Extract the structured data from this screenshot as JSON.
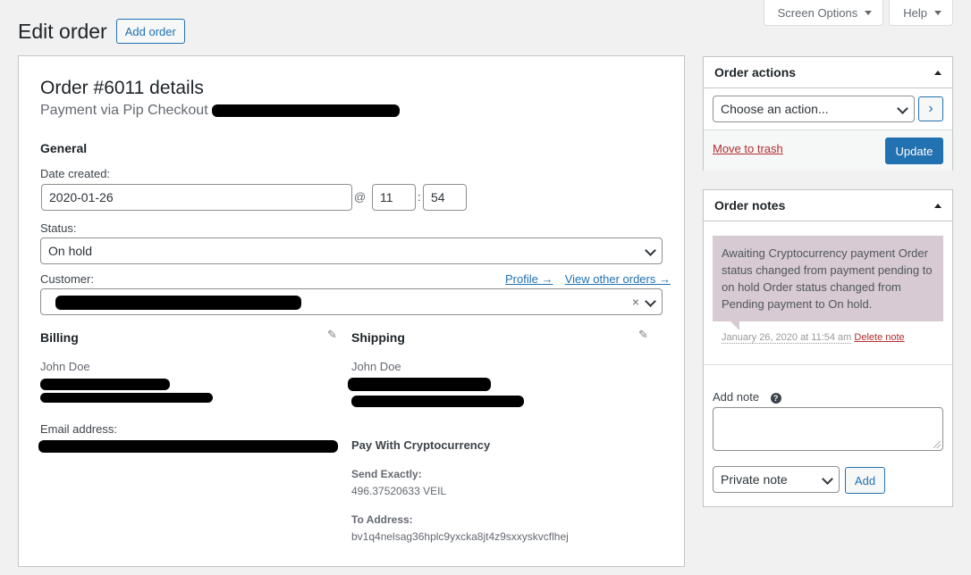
{
  "screen_meta": {
    "screen_options_label": "Screen Options",
    "help_label": "Help"
  },
  "header": {
    "title": "Edit order",
    "add_order_label": "Add order"
  },
  "order": {
    "title": "Order #6011 details",
    "payment_via": "Payment via Pip Checkout",
    "general_heading": "General",
    "date_created_label": "Date created:",
    "date_value": "2020-01-26",
    "at_symbol": "@",
    "hour_value": "11",
    "time_sep": ":",
    "minute_value": "54",
    "status_label": "Status:",
    "status_value": "On hold",
    "customer_label": "Customer:",
    "profile_link": "Profile →",
    "view_other_orders_link": "View other orders →",
    "customer_clear": "×"
  },
  "billing": {
    "heading": "Billing",
    "name": "John Doe",
    "email_label": "Email address:"
  },
  "shipping": {
    "heading": "Shipping",
    "name": "John Doe"
  },
  "crypto": {
    "heading": "Pay With Cryptocurrency",
    "send_exactly_label": "Send Exactly:",
    "send_exactly_value": "496.37520633 VEIL",
    "to_address_label": "To Address:",
    "to_address_value": "bv1q4nelsag36hplc9yxcka8jt4z9sxxyskvcflhej"
  },
  "order_actions": {
    "title": "Order actions",
    "select_value": "Choose an action...",
    "go_label": "›",
    "trash_label": "Move to trash",
    "update_label": "Update"
  },
  "order_notes": {
    "title": "Order notes",
    "note_text": "Awaiting Cryptocurrency payment Order status changed from payment pending to on hold Order status changed from Pending payment to On hold.",
    "note_date": "January 26, 2020 at 11:54 am",
    "delete_label": "Delete note",
    "add_note_label": "Add note",
    "help_glyph": "?",
    "note_type_value": "Private note",
    "add_button_label": "Add"
  },
  "icons": {
    "pencil": "✎",
    "caret_down": "caret-down-icon",
    "chevron_down": "chevron-down-icon",
    "caret_up": "caret-up-icon"
  },
  "colors": {
    "primary": "#2271b1",
    "danger": "#b32d2e",
    "note_bg": "#d7cad2",
    "page_bg": "#f1f1f1"
  }
}
